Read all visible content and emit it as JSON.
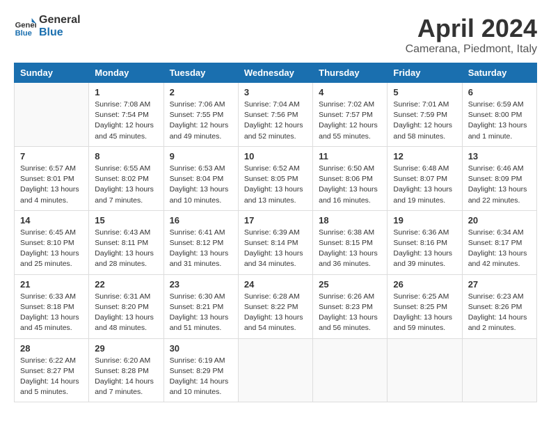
{
  "header": {
    "logo_general": "General",
    "logo_blue": "Blue",
    "title": "April 2024",
    "location": "Camerana, Piedmont, Italy"
  },
  "weekdays": [
    "Sunday",
    "Monday",
    "Tuesday",
    "Wednesday",
    "Thursday",
    "Friday",
    "Saturday"
  ],
  "weeks": [
    [
      {
        "day": "",
        "info": ""
      },
      {
        "day": "1",
        "info": "Sunrise: 7:08 AM\nSunset: 7:54 PM\nDaylight: 12 hours\nand 45 minutes."
      },
      {
        "day": "2",
        "info": "Sunrise: 7:06 AM\nSunset: 7:55 PM\nDaylight: 12 hours\nand 49 minutes."
      },
      {
        "day": "3",
        "info": "Sunrise: 7:04 AM\nSunset: 7:56 PM\nDaylight: 12 hours\nand 52 minutes."
      },
      {
        "day": "4",
        "info": "Sunrise: 7:02 AM\nSunset: 7:57 PM\nDaylight: 12 hours\nand 55 minutes."
      },
      {
        "day": "5",
        "info": "Sunrise: 7:01 AM\nSunset: 7:59 PM\nDaylight: 12 hours\nand 58 minutes."
      },
      {
        "day": "6",
        "info": "Sunrise: 6:59 AM\nSunset: 8:00 PM\nDaylight: 13 hours\nand 1 minute."
      }
    ],
    [
      {
        "day": "7",
        "info": "Sunrise: 6:57 AM\nSunset: 8:01 PM\nDaylight: 13 hours\nand 4 minutes."
      },
      {
        "day": "8",
        "info": "Sunrise: 6:55 AM\nSunset: 8:02 PM\nDaylight: 13 hours\nand 7 minutes."
      },
      {
        "day": "9",
        "info": "Sunrise: 6:53 AM\nSunset: 8:04 PM\nDaylight: 13 hours\nand 10 minutes."
      },
      {
        "day": "10",
        "info": "Sunrise: 6:52 AM\nSunset: 8:05 PM\nDaylight: 13 hours\nand 13 minutes."
      },
      {
        "day": "11",
        "info": "Sunrise: 6:50 AM\nSunset: 8:06 PM\nDaylight: 13 hours\nand 16 minutes."
      },
      {
        "day": "12",
        "info": "Sunrise: 6:48 AM\nSunset: 8:07 PM\nDaylight: 13 hours\nand 19 minutes."
      },
      {
        "day": "13",
        "info": "Sunrise: 6:46 AM\nSunset: 8:09 PM\nDaylight: 13 hours\nand 22 minutes."
      }
    ],
    [
      {
        "day": "14",
        "info": "Sunrise: 6:45 AM\nSunset: 8:10 PM\nDaylight: 13 hours\nand 25 minutes."
      },
      {
        "day": "15",
        "info": "Sunrise: 6:43 AM\nSunset: 8:11 PM\nDaylight: 13 hours\nand 28 minutes."
      },
      {
        "day": "16",
        "info": "Sunrise: 6:41 AM\nSunset: 8:12 PM\nDaylight: 13 hours\nand 31 minutes."
      },
      {
        "day": "17",
        "info": "Sunrise: 6:39 AM\nSunset: 8:14 PM\nDaylight: 13 hours\nand 34 minutes."
      },
      {
        "day": "18",
        "info": "Sunrise: 6:38 AM\nSunset: 8:15 PM\nDaylight: 13 hours\nand 36 minutes."
      },
      {
        "day": "19",
        "info": "Sunrise: 6:36 AM\nSunset: 8:16 PM\nDaylight: 13 hours\nand 39 minutes."
      },
      {
        "day": "20",
        "info": "Sunrise: 6:34 AM\nSunset: 8:17 PM\nDaylight: 13 hours\nand 42 minutes."
      }
    ],
    [
      {
        "day": "21",
        "info": "Sunrise: 6:33 AM\nSunset: 8:18 PM\nDaylight: 13 hours\nand 45 minutes."
      },
      {
        "day": "22",
        "info": "Sunrise: 6:31 AM\nSunset: 8:20 PM\nDaylight: 13 hours\nand 48 minutes."
      },
      {
        "day": "23",
        "info": "Sunrise: 6:30 AM\nSunset: 8:21 PM\nDaylight: 13 hours\nand 51 minutes."
      },
      {
        "day": "24",
        "info": "Sunrise: 6:28 AM\nSunset: 8:22 PM\nDaylight: 13 hours\nand 54 minutes."
      },
      {
        "day": "25",
        "info": "Sunrise: 6:26 AM\nSunset: 8:23 PM\nDaylight: 13 hours\nand 56 minutes."
      },
      {
        "day": "26",
        "info": "Sunrise: 6:25 AM\nSunset: 8:25 PM\nDaylight: 13 hours\nand 59 minutes."
      },
      {
        "day": "27",
        "info": "Sunrise: 6:23 AM\nSunset: 8:26 PM\nDaylight: 14 hours\nand 2 minutes."
      }
    ],
    [
      {
        "day": "28",
        "info": "Sunrise: 6:22 AM\nSunset: 8:27 PM\nDaylight: 14 hours\nand 5 minutes."
      },
      {
        "day": "29",
        "info": "Sunrise: 6:20 AM\nSunset: 8:28 PM\nDaylight: 14 hours\nand 7 minutes."
      },
      {
        "day": "30",
        "info": "Sunrise: 6:19 AM\nSunset: 8:29 PM\nDaylight: 14 hours\nand 10 minutes."
      },
      {
        "day": "",
        "info": ""
      },
      {
        "day": "",
        "info": ""
      },
      {
        "day": "",
        "info": ""
      },
      {
        "day": "",
        "info": ""
      }
    ]
  ]
}
